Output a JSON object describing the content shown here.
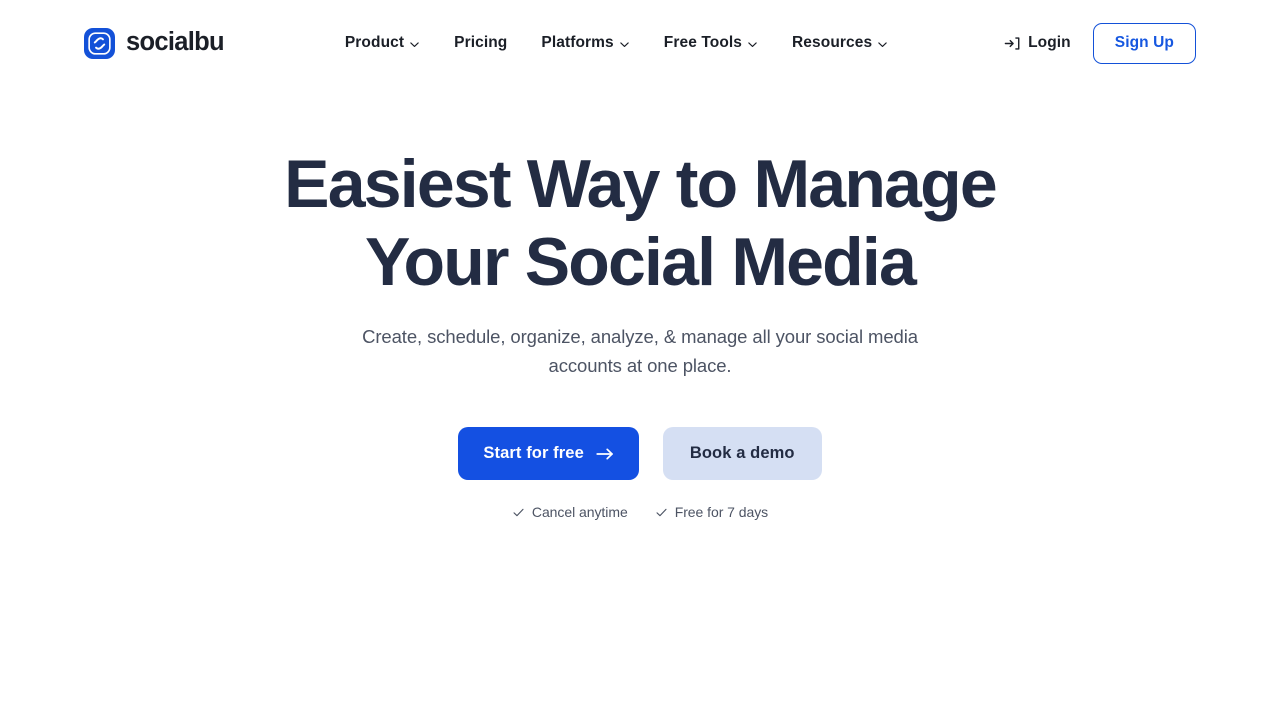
{
  "brand": {
    "name": "socialbu",
    "logo_icon": "socialbu-s-logo-icon",
    "logo_color": "#1351d8"
  },
  "header": {
    "nav_items": [
      {
        "label": "Product",
        "has_dropdown": true,
        "icon": "chevron-down-icon"
      },
      {
        "label": "Pricing",
        "has_dropdown": false,
        "icon": ""
      },
      {
        "label": "Platforms",
        "has_dropdown": true,
        "icon": "chevron-down-icon"
      },
      {
        "label": "Free Tools",
        "has_dropdown": true,
        "icon": "chevron-down-icon"
      },
      {
        "label": "Resources",
        "has_dropdown": true,
        "icon": "chevron-down-icon"
      }
    ],
    "login": {
      "label": "Login",
      "icon": "sign-in-icon"
    },
    "signup": {
      "label": "Sign Up",
      "accent_color": "#1351d8"
    }
  },
  "hero": {
    "title_line1": "Easiest Way to Manage",
    "title_line2": "Your Social Media",
    "title_color": "#232c43",
    "subtitle": "Create, schedule, organize, analyze, & manage all your social media accounts at one place.",
    "primary_cta": {
      "label": "Start for free",
      "icon": "arrow-right-icon",
      "bg_color": "#1450e2"
    },
    "secondary_cta": {
      "label": "Book a demo",
      "bg_color": "#d5dff3"
    },
    "notes": [
      {
        "label": "Cancel anytime",
        "icon": "check-icon"
      },
      {
        "label": "Free for 7 days",
        "icon": "check-icon"
      }
    ]
  }
}
